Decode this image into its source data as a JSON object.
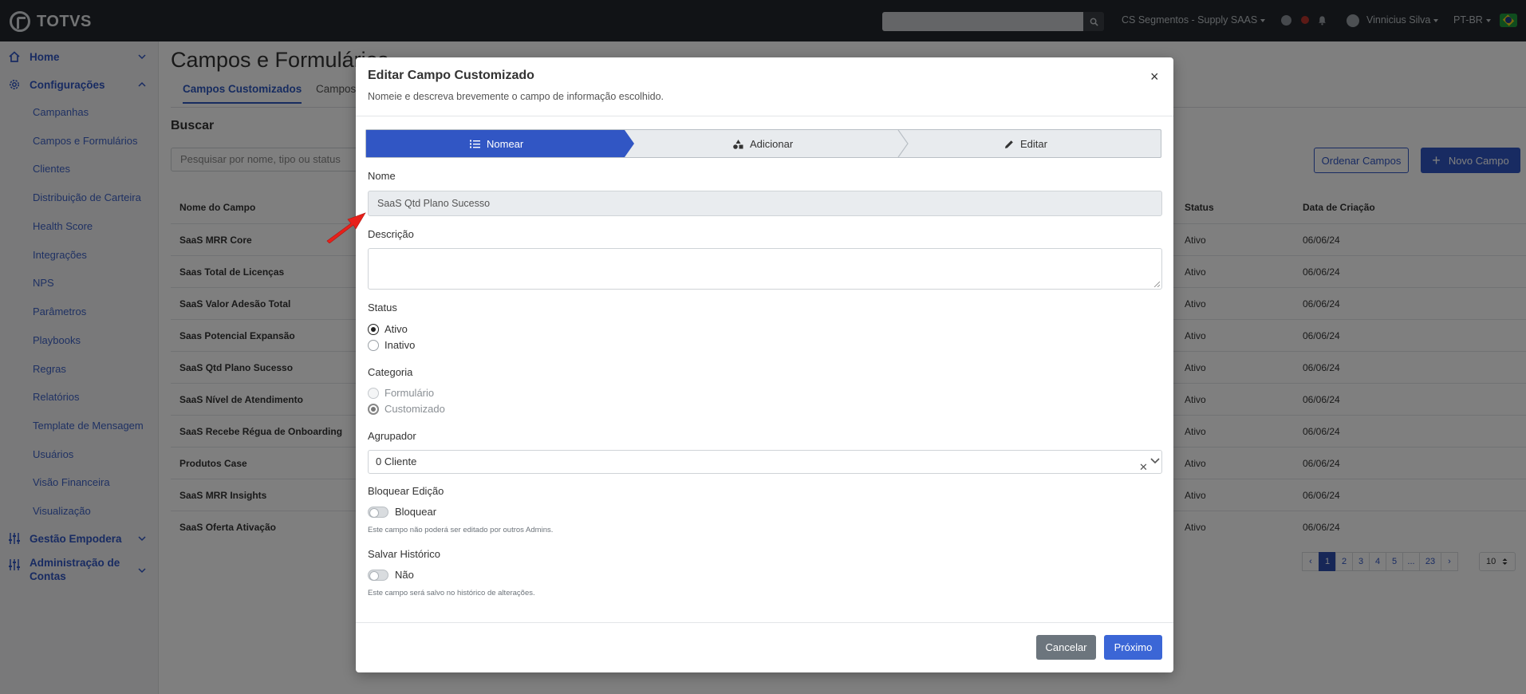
{
  "topbar": {
    "logo": "TOTVS",
    "org_label": "CS Segmentos - Supply SAAS",
    "user_name": "Vinnicius Silva",
    "language": "PT-BR"
  },
  "sidebar": {
    "groups": [
      {
        "label": "Home"
      },
      {
        "label": "Configurações"
      },
      {
        "label": "Gestão Empodera"
      },
      {
        "label": "Administração de Contas"
      }
    ],
    "items": [
      "Campanhas",
      "Campos e Formulários",
      "Clientes",
      "Distribuição de Carteira",
      "Health Score",
      "Integrações",
      "NPS",
      "Parâmetros",
      "Playbooks",
      "Regras",
      "Relatórios",
      "Template de Mensagem",
      "Usuários",
      "Visão Financeira",
      "Visualização"
    ]
  },
  "main": {
    "title": "Campos e Formulários",
    "tabs": [
      "Campos Customizados",
      "Campos"
    ],
    "search_heading": "Buscar",
    "search_placeholder": "Pesquisar por nome, tipo ou status",
    "btn_order": "Ordenar Campos",
    "btn_new": "Novo Campo",
    "columns": [
      "Nome do Campo",
      "Status",
      "Data de Criação"
    ],
    "rows": [
      {
        "name": "SaaS MRR Core",
        "status": "Ativo",
        "date": "06/06/24"
      },
      {
        "name": "Saas Total de Licenças",
        "status": "Ativo",
        "date": "06/06/24"
      },
      {
        "name": "SaaS Valor Adesão Total",
        "status": "Ativo",
        "date": "06/06/24"
      },
      {
        "name": "Saas Potencial Expansão",
        "status": "Ativo",
        "date": "06/06/24"
      },
      {
        "name": "SaaS Qtd Plano Sucesso",
        "status": "Ativo",
        "date": "06/06/24"
      },
      {
        "name": "SaaS Nível de Atendimento",
        "status": "Ativo",
        "date": "06/06/24"
      },
      {
        "name": "SaaS Recebe Régua de Onboarding",
        "status": "Ativo",
        "date": "06/06/24"
      },
      {
        "name": "Produtos Case",
        "status": "Ativo",
        "date": "06/06/24"
      },
      {
        "name": "SaaS MRR Insights",
        "status": "Ativo",
        "date": "06/06/24"
      },
      {
        "name": "SaaS Oferta Ativação",
        "status": "Ativo",
        "date": "06/06/24"
      }
    ],
    "pagination": {
      "prev": "‹",
      "pages": [
        "1",
        "2",
        "3",
        "4",
        "5",
        "...",
        "23"
      ],
      "next": "›",
      "per_page": "10"
    }
  },
  "modal": {
    "title": "Editar Campo Customizado",
    "subtitle": "Nomeie e descreva brevemente o campo de informação escolhido.",
    "close": "×",
    "steps": [
      "Nomear",
      "Adicionar",
      "Editar"
    ],
    "name_label": "Nome",
    "name_value": "SaaS Qtd Plano Sucesso",
    "description_label": "Descrição",
    "description_value": "",
    "status_label": "Status",
    "status_options": [
      "Ativo",
      "Inativo"
    ],
    "status_selected": "Ativo",
    "category_label": "Categoria",
    "category_options": [
      "Formulário",
      "Customizado"
    ],
    "category_selected": "Customizado",
    "grouper_label": "Agrupador",
    "grouper_value": "0 Cliente",
    "lock_label": "Bloquear Edição",
    "lock_toggle": "Bloquear",
    "lock_help": "Este campo não poderá ser editado por outros Admins.",
    "history_label": "Salvar Histórico",
    "history_toggle": "Não",
    "history_help": "Este campo será salvo no histórico de alterações.",
    "btn_cancel": "Cancelar",
    "btn_next": "Próximo"
  },
  "colors": {
    "accent": "#3156c4",
    "topbar": "#22272c",
    "annotation_arrow": "#e8201a"
  }
}
